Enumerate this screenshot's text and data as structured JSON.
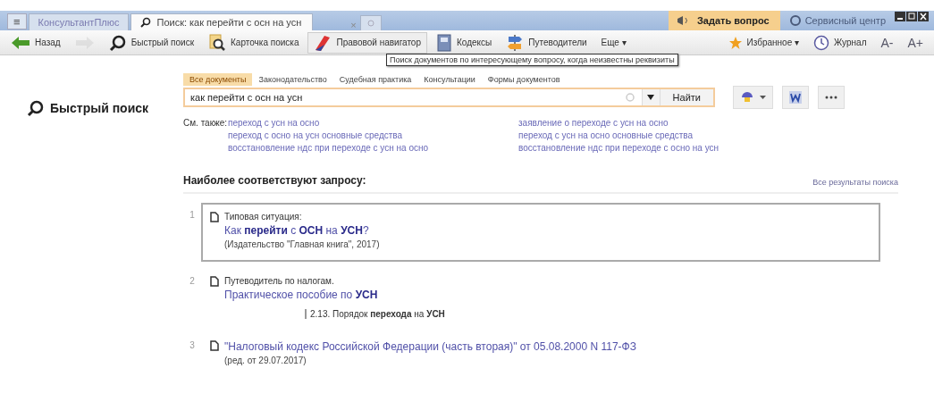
{
  "title_bar": {
    "menu_button": "≡",
    "tabs": [
      {
        "label": "КонсультантПлюс",
        "selected": false
      },
      {
        "label": "Поиск: как перейти с осн на усн",
        "selected": true
      }
    ],
    "close_tab": "×",
    "ask_button": "Задать вопрос",
    "service_button": {
      "label": "Сервисный центр",
      "disabled": true
    }
  },
  "toolbar": {
    "left": [
      {
        "kind": "back",
        "label": "Назад",
        "disabled": false
      },
      {
        "kind": "forward",
        "disabled": true
      },
      {
        "kind": "search",
        "label": "Быстрый поиск",
        "disabled": false
      },
      {
        "kind": "card",
        "label": "Карточка поиска",
        "disabled": false
      },
      {
        "kind": "navigator",
        "label": "Правовой навигатор",
        "disabled": false
      },
      {
        "kind": "codes",
        "label": "Кодексы",
        "disabled": false
      },
      {
        "kind": "guides",
        "label": "Путеводители",
        "disabled": false
      },
      {
        "kind": "more",
        "label": "Еще ▾",
        "disabled": false
      }
    ],
    "right": [
      {
        "kind": "star",
        "label": "Избранное ▾"
      },
      {
        "kind": "clock",
        "label": "Журнал"
      },
      {
        "kind": "text",
        "label": "А-"
      },
      {
        "kind": "text",
        "label": "А+"
      }
    ],
    "tooltip": "Поиск документов по интересующему вопросу, когда неизвестны реквизиты"
  },
  "quick_search": {
    "title": "Быстрый поиск",
    "tabs": [
      {
        "label": "Все документы",
        "selected": true
      },
      {
        "label": "Законодательство",
        "selected": false
      },
      {
        "label": "Судебная практика",
        "selected": false
      },
      {
        "label": "Консультации",
        "selected": false
      },
      {
        "label": "Формы документов",
        "selected": false
      }
    ],
    "query": "как перейти с осн на усн",
    "find_button": "Найти",
    "see_also_label": "См. также:",
    "see_also": [
      [
        "переход с усн на осно",
        "переход с осно на усн основные средства",
        "восстановление ндс при переходе с усн на осно"
      ],
      [
        "заявление о переходе с усн на осно",
        "переход с усн на осно основные средства",
        "восстановление ндс при переходе с осно на усн"
      ]
    ]
  },
  "results": {
    "heading": "Наиболее соответствуют запросу:",
    "all_link": "Все результаты поиска",
    "items": [
      {
        "number": "1",
        "selected": true,
        "category": "Типовая ситуация:",
        "title": "Как **перейти** с **ОСН** на **УСН**?",
        "source": "(Издательство \"Главная книга\", 2017)"
      },
      {
        "number": "2",
        "selected": false,
        "category": "Путеводитель по налогам.",
        "title": "Практическое пособие по **УСН**",
        "section": "2.13. Порядок **перехода** на **УСН**"
      },
      {
        "number": "3",
        "selected": false,
        "title": "\"Налоговый кодекс Российской Федерации (часть вторая)\" от 05.08.2000 N 117-ФЗ",
        "source": "(ред. от 29.07.2017)"
      }
    ]
  }
}
